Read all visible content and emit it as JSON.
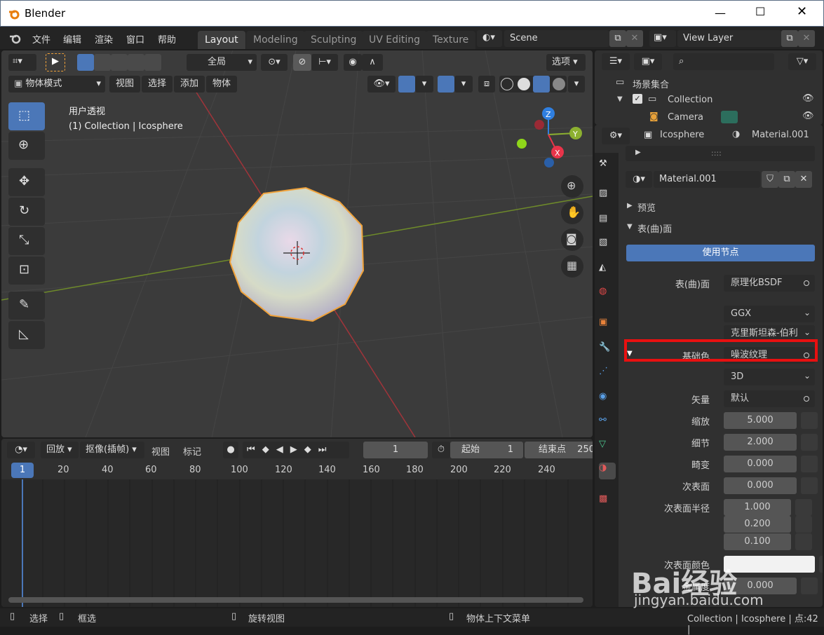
{
  "window": {
    "title": "Blender"
  },
  "menu": {
    "items": [
      "文件",
      "编辑",
      "渲染",
      "窗口",
      "帮助"
    ]
  },
  "workspaces": [
    "Layout",
    "Modeling",
    "Sculpting",
    "UV Editing",
    "Texture"
  ],
  "scene": {
    "name": "Scene",
    "view_layer": "View Layer"
  },
  "viewport": {
    "transform_orientation": "全局",
    "options_label": "选项",
    "mode": "物体模式",
    "header_menus": [
      "视图",
      "选择",
      "添加",
      "物体"
    ],
    "overlay_title": "用户透视",
    "overlay_subtitle": "(1) Collection | Icosphere",
    "gizmo_axes": [
      "Z",
      "Y",
      "X"
    ]
  },
  "timeline": {
    "playback": "回放",
    "keying": "抠像(插帧)",
    "menus": [
      "视图",
      "标记"
    ],
    "current_frame": "1",
    "start_label": "起始",
    "start_value": "1",
    "end_label": "结束点",
    "end_value": "250",
    "ticks": [
      "1",
      "20",
      "40",
      "60",
      "80",
      "100",
      "120",
      "140",
      "160",
      "180",
      "200",
      "220",
      "240"
    ]
  },
  "outliner": {
    "root": "场景集合",
    "items": [
      "Collection",
      "Camera"
    ]
  },
  "properties": {
    "object_name": "Icosphere",
    "material_name": "Material.001",
    "slot_material": "Material.001",
    "dots": "::::",
    "panels": {
      "preview": "预览",
      "surface": "表(曲)面"
    },
    "use_nodes": "使用节点",
    "rows": [
      {
        "label": "表(曲)面",
        "value": "原理化BSDF",
        "kind": "link"
      },
      {
        "label": "",
        "value": "GGX",
        "kind": "select"
      },
      {
        "label": "",
        "value": "克里斯坦森-伯利",
        "kind": "select"
      },
      {
        "label": "基础色",
        "value": "噪波纹理",
        "kind": "link",
        "highlight": true
      },
      {
        "label": "",
        "value": "3D",
        "kind": "select"
      },
      {
        "label": "矢量",
        "value": "默认",
        "kind": "link"
      },
      {
        "label": "缩放",
        "value": "5.000",
        "kind": "num"
      },
      {
        "label": "细节",
        "value": "2.000",
        "kind": "num"
      },
      {
        "label": "畸变",
        "value": "0.000",
        "kind": "num"
      },
      {
        "label": "次表面",
        "value": "0.000",
        "kind": "num"
      },
      {
        "label": "次表面半径",
        "value": "1.000",
        "kind": "num"
      },
      {
        "label": "",
        "value": "0.200",
        "kind": "num"
      },
      {
        "label": "",
        "value": "0.100",
        "kind": "num"
      },
      {
        "label": "次表面颜色",
        "value": "",
        "kind": "color"
      },
      {
        "label": "金属度",
        "value": "0.000",
        "kind": "num"
      }
    ]
  },
  "statusbar": {
    "select": "选择",
    "box_select": "框选",
    "rotate_view": "旋转视图",
    "context_menu": "物体上下文菜单",
    "info": "Collection | Icosphere | 点:42 |"
  },
  "watermark": {
    "brand": "Bai经验",
    "url": "jingyan.baidu.com"
  },
  "colors": {
    "accent": "#4b77b8",
    "highlight_box": "#e81010",
    "selection_outline": "#f0a23a"
  }
}
